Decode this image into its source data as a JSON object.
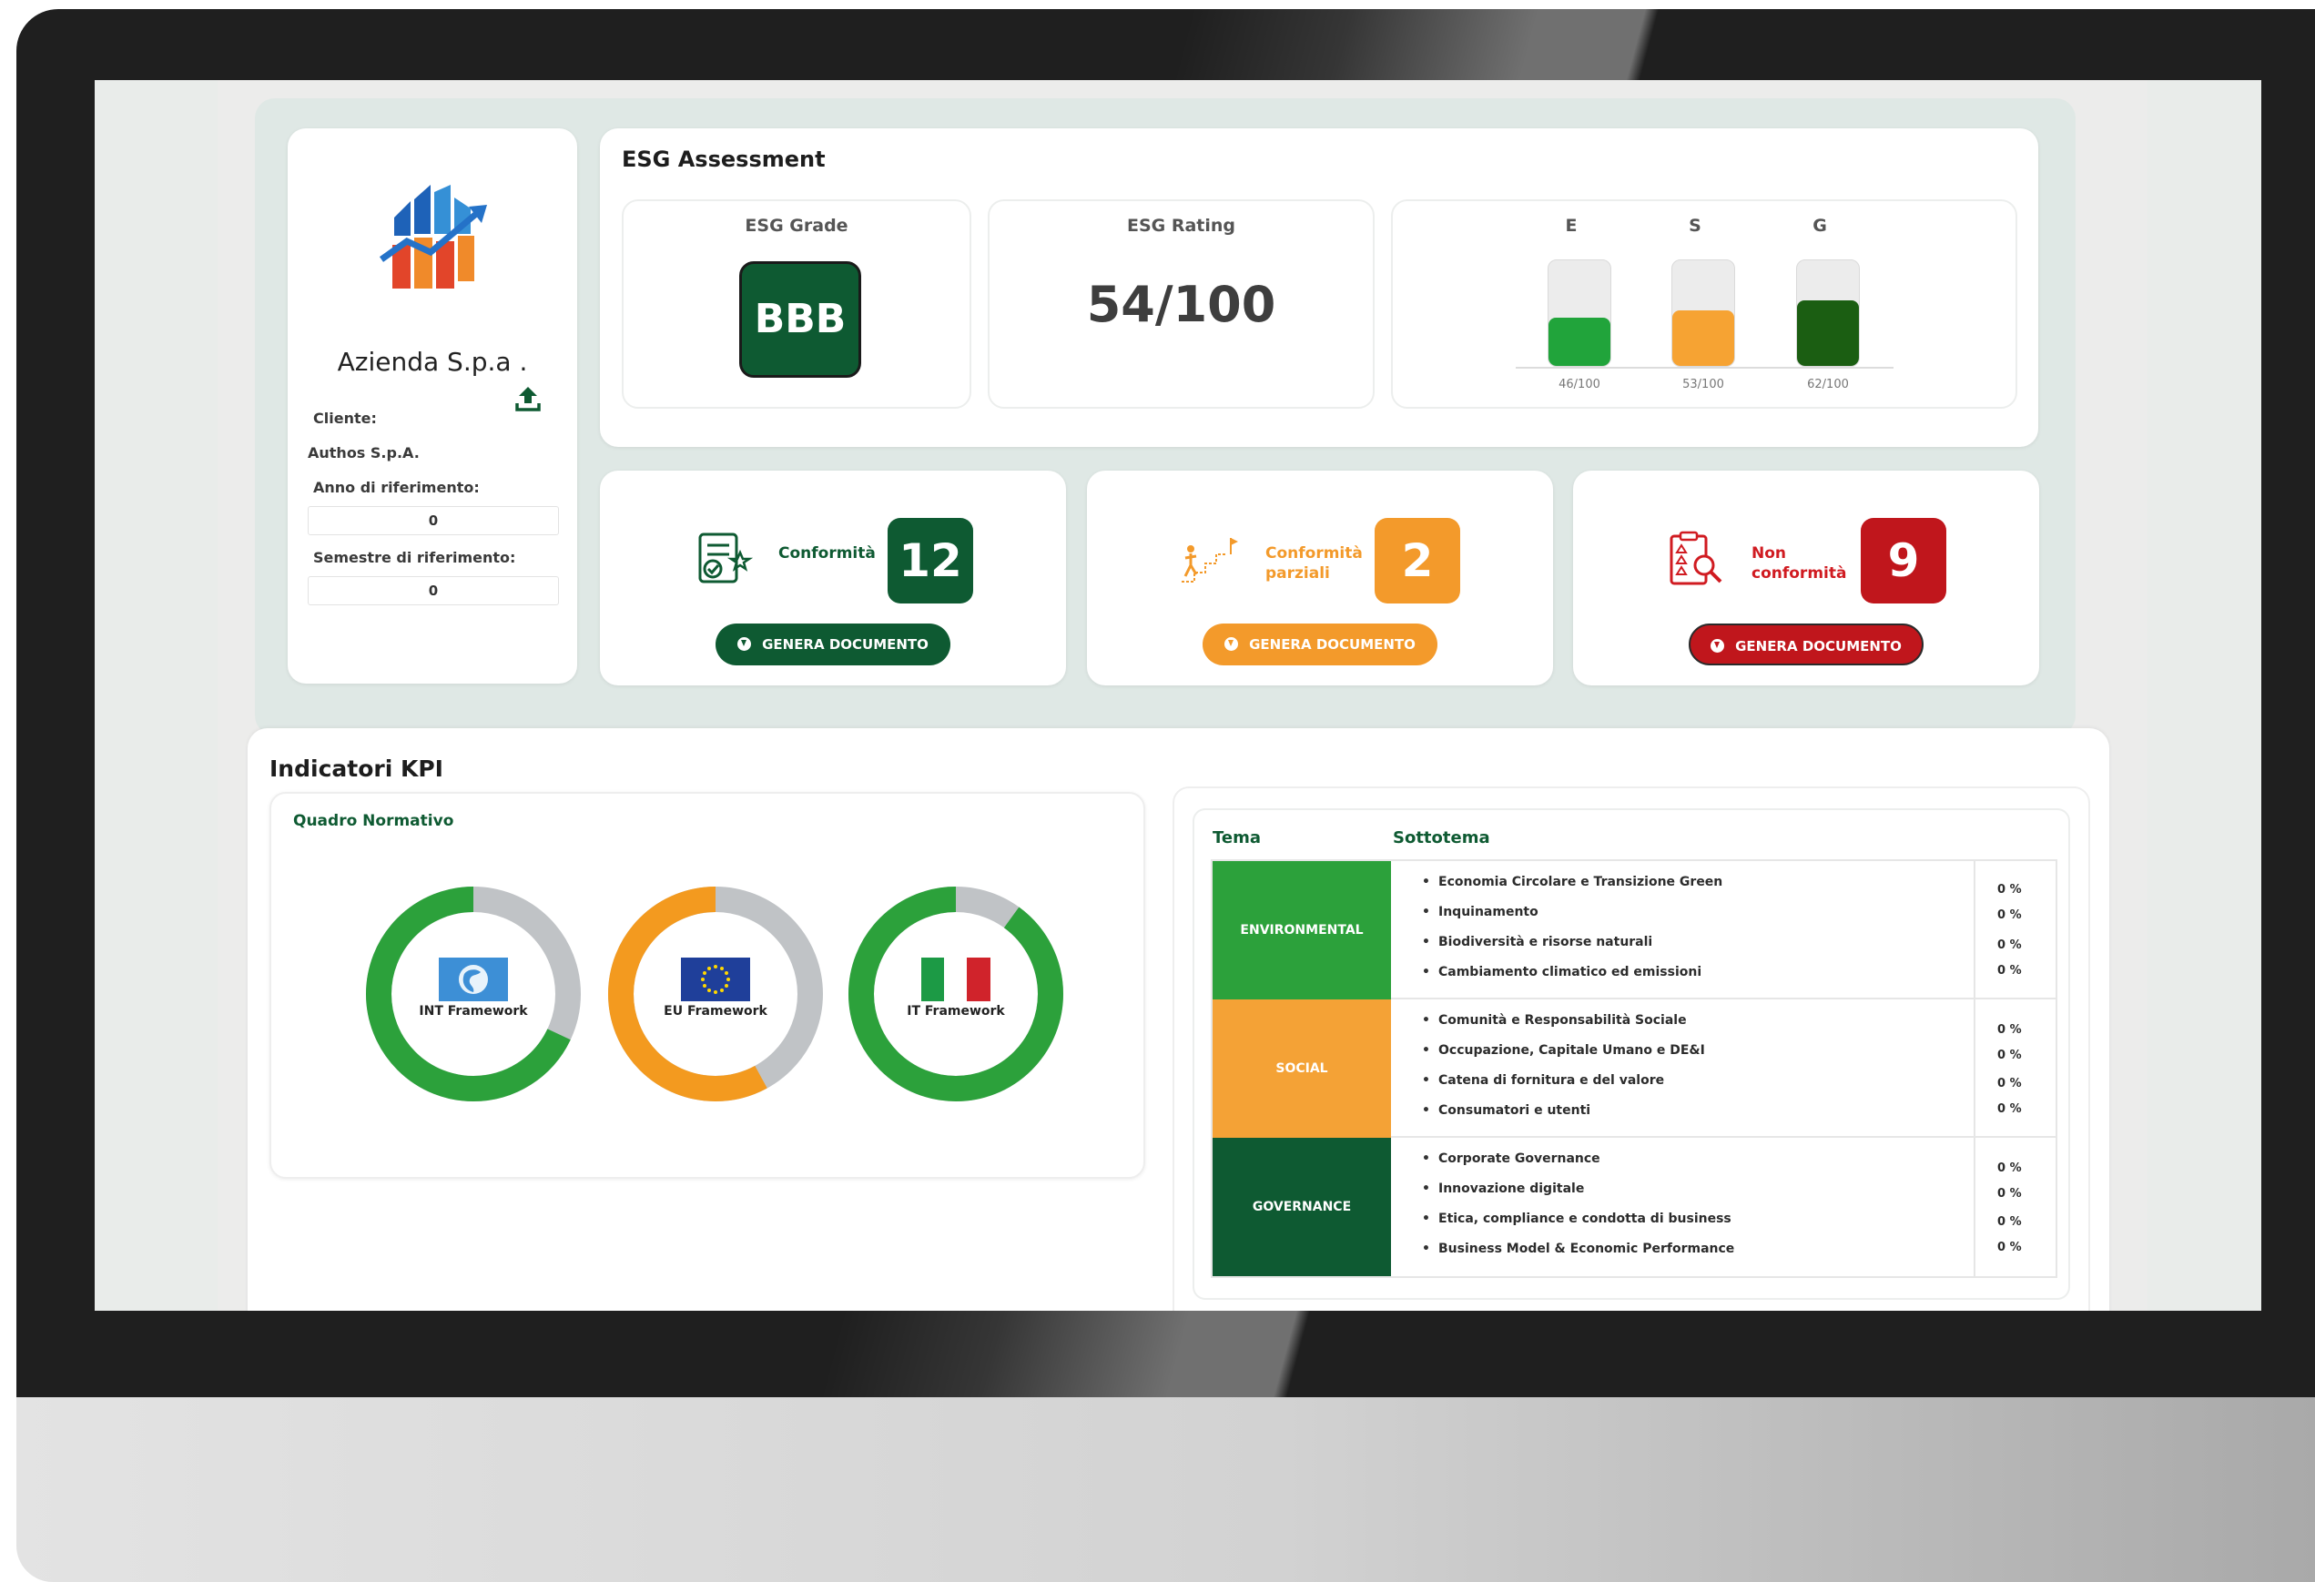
{
  "company": {
    "name": "Azienda S.p.a .",
    "client_label": "Cliente:",
    "client_value": "Authos S.p.A.",
    "year_label": "Anno di riferimento:",
    "year_value": "0",
    "semester_label": "Semestre di riferimento:",
    "semester_value": "0"
  },
  "esg": {
    "title": "ESG Assessment",
    "grade_label": "ESG Grade",
    "grade_value": "BBB",
    "rating_label": "ESG Rating",
    "rating_value": "54/100",
    "bars": [
      {
        "letter": "E",
        "score": 46,
        "label": "46/100",
        "color": "#21a43b"
      },
      {
        "letter": "S",
        "score": 53,
        "label": "53/100",
        "color": "#f6a333"
      },
      {
        "letter": "G",
        "score": 62,
        "label": "62/100",
        "color": "#1b5e12"
      }
    ]
  },
  "conformity": [
    {
      "label_line1": "Conformità",
      "label_line2": "",
      "count": "12",
      "color": "#0e5a32",
      "text_color": "#0e5a32",
      "button": "GENERA DOCUMENTO",
      "icon": "document-check-icon"
    },
    {
      "label_line1": "Conformità",
      "label_line2": "parziali",
      "count": "2",
      "color": "#f39a2b",
      "text_color": "#f39a2b",
      "button": "GENERA DOCUMENTO",
      "icon": "stairs-climber-icon"
    },
    {
      "label_line1": "Non",
      "label_line2": "conformità",
      "count": "9",
      "color": "#c0161c",
      "text_color": "#d01b21",
      "button": "GENERA DOCUMENTO",
      "icon": "clipboard-search-icon"
    }
  ],
  "kpi": {
    "title": "Indicatori KPI",
    "quadro_title": "Quadro Normativo",
    "frameworks": [
      {
        "label": "INT Framework",
        "fraction": 0.68,
        "color": "#2ca13b",
        "flag": "globe-flag-icon"
      },
      {
        "label": "EU Framework",
        "fraction": 0.58,
        "color": "#f39a1f",
        "flag": "eu-flag-icon"
      },
      {
        "label": "IT Framework",
        "fraction": 0.9,
        "color": "#2ca13b",
        "flag": "italy-flag-icon"
      }
    ],
    "table": {
      "col_tema": "Tema",
      "col_sottotema": "Sottotema",
      "rows": [
        {
          "tema": "ENVIRONMENTAL",
          "color": "#2ca13b",
          "items": [
            "Economia Circolare e Transizione Green",
            "Inquinamento",
            "Biodiversità e risorse naturali",
            "Cambiamento climatico ed emissioni"
          ],
          "pcts": [
            "0 %",
            "0 %",
            "0 %",
            "0 %"
          ]
        },
        {
          "tema": "SOCIAL",
          "color": "#f4a236",
          "items": [
            "Comunità e Responsabilità Sociale",
            "Occupazione, Capitale Umano e DE&I",
            "Catena di fornitura e del valore",
            "Consumatori e utenti"
          ],
          "pcts": [
            "0 %",
            "0 %",
            "0 %",
            "0 %"
          ]
        },
        {
          "tema": "GOVERNANCE",
          "color": "#0e5a32",
          "items": [
            "Corporate Governance",
            "Innovazione digitale",
            "Etica, compliance e condotta di business",
            "Business Model & Economic Performance"
          ],
          "pcts": [
            "0 %",
            "0 %",
            "0 %",
            "0 %"
          ]
        }
      ]
    }
  }
}
